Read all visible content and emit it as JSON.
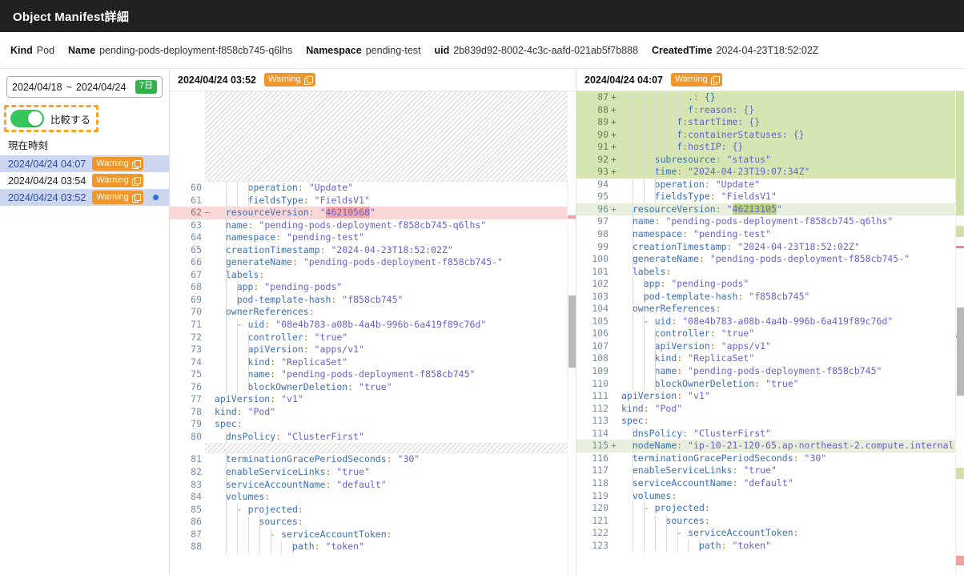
{
  "titlebar": {
    "title": "Object Manifest詳細"
  },
  "meta": [
    {
      "key": "Kind",
      "value": "Pod"
    },
    {
      "key": "Name",
      "value": "pending-pods-deployment-f858cb745-q6lhs"
    },
    {
      "key": "Namespace",
      "value": "pending-test"
    },
    {
      "key": "uid",
      "value": "2b839d92-8002-4c3c-aafd-021ab5f7b888"
    },
    {
      "key": "CreatedTime",
      "value": "2024-04-23T18:52:02Z"
    }
  ],
  "sidebar": {
    "date_range": {
      "from": "2024/04/18",
      "sep": "~",
      "to": "2024/04/24",
      "badge": "7日"
    },
    "compare_toggle": {
      "label": "比較する",
      "state": "on"
    },
    "now_label": "現在時刻",
    "snapshots": [
      {
        "timestamp": "2024/04/24 04:07",
        "severity": "Warning",
        "selected": true,
        "marker": false
      },
      {
        "timestamp": "2024/04/24 03:54",
        "severity": "Warning",
        "selected": false,
        "marker": false
      },
      {
        "timestamp": "2024/04/24 03:52",
        "severity": "Warning",
        "selected": true,
        "marker": true
      }
    ]
  },
  "colors": {
    "titlebar_bg": "#212121",
    "warning_chip": "#f0962a",
    "toggle_on": "#35c759",
    "badge_green": "#2eb24a",
    "selected_row": "#ccd6f0",
    "diff_add": "#d6e6b3",
    "diff_del": "#fbd7d7",
    "highlight_add": "#b9d47a",
    "highlight_del": "#f4a8a4",
    "accent_dashed": "#f5a623"
  },
  "panes": {
    "left": {
      "header_timestamp": "2024/04/24 03:52",
      "header_severity": "Warning",
      "leading_collapsed": true,
      "lines": [
        {
          "n": "60",
          "sign": "",
          "indent": 3,
          "text": "operation: \"Update\"",
          "state": ""
        },
        {
          "n": "61",
          "sign": "",
          "indent": 3,
          "text": "fieldsType: \"FieldsV1\"",
          "state": ""
        },
        {
          "n": "62",
          "sign": "−",
          "indent": 1,
          "text": "resourceVersion: \"46210568\"",
          "state": "del",
          "hl": "46210568"
        },
        {
          "n": "63",
          "sign": "",
          "indent": 1,
          "text": "name: \"pending-pods-deployment-f858cb745-q6lhs\"",
          "state": ""
        },
        {
          "n": "64",
          "sign": "",
          "indent": 1,
          "text": "namespace: \"pending-test\"",
          "state": ""
        },
        {
          "n": "65",
          "sign": "",
          "indent": 1,
          "text": "creationTimestamp: \"2024-04-23T18:52:02Z\"",
          "state": ""
        },
        {
          "n": "66",
          "sign": "",
          "indent": 1,
          "text": "generateName: \"pending-pods-deployment-f858cb745-\"",
          "state": ""
        },
        {
          "n": "67",
          "sign": "",
          "indent": 1,
          "text": "labels:",
          "state": ""
        },
        {
          "n": "68",
          "sign": "",
          "indent": 2,
          "text": "app: \"pending-pods\"",
          "state": ""
        },
        {
          "n": "69",
          "sign": "",
          "indent": 2,
          "text": "pod-template-hash: \"f858cb745\"",
          "state": ""
        },
        {
          "n": "70",
          "sign": "",
          "indent": 1,
          "text": "ownerReferences:",
          "state": ""
        },
        {
          "n": "71",
          "sign": "",
          "indent": 2,
          "text": "- uid: \"08e4b783-a08b-4a4b-996b-6a419f89c76d\"",
          "state": ""
        },
        {
          "n": "72",
          "sign": "",
          "indent": 3,
          "text": "controller: \"true\"",
          "state": ""
        },
        {
          "n": "73",
          "sign": "",
          "indent": 3,
          "text": "apiVersion: \"apps/v1\"",
          "state": ""
        },
        {
          "n": "74",
          "sign": "",
          "indent": 3,
          "text": "kind: \"ReplicaSet\"",
          "state": ""
        },
        {
          "n": "75",
          "sign": "",
          "indent": 3,
          "text": "name: \"pending-pods-deployment-f858cb745\"",
          "state": ""
        },
        {
          "n": "76",
          "sign": "",
          "indent": 3,
          "text": "blockOwnerDeletion: \"true\"",
          "state": ""
        },
        {
          "n": "77",
          "sign": "",
          "indent": 0,
          "text": "apiVersion: \"v1\"",
          "state": ""
        },
        {
          "n": "78",
          "sign": "",
          "indent": 0,
          "text": "kind: \"Pod\"",
          "state": ""
        },
        {
          "n": "79",
          "sign": "",
          "indent": 0,
          "text": "spec:",
          "state": ""
        },
        {
          "n": "80",
          "sign": "",
          "indent": 1,
          "text": "dnsPolicy: \"ClusterFirst\"",
          "state": ""
        },
        {
          "n": "",
          "sign": "",
          "indent": 0,
          "text": "",
          "state": "hatch"
        },
        {
          "n": "81",
          "sign": "",
          "indent": 1,
          "text": "terminationGracePeriodSeconds: \"30\"",
          "state": ""
        },
        {
          "n": "82",
          "sign": "",
          "indent": 1,
          "text": "enableServiceLinks: \"true\"",
          "state": ""
        },
        {
          "n": "83",
          "sign": "",
          "indent": 1,
          "text": "serviceAccountName: \"default\"",
          "state": ""
        },
        {
          "n": "84",
          "sign": "",
          "indent": 1,
          "text": "volumes:",
          "state": ""
        },
        {
          "n": "85",
          "sign": "",
          "indent": 2,
          "text": "- projected:",
          "state": ""
        },
        {
          "n": "86",
          "sign": "",
          "indent": 4,
          "text": "sources:",
          "state": ""
        },
        {
          "n": "87",
          "sign": "",
          "indent": 5,
          "text": "- serviceAccountToken:",
          "state": ""
        },
        {
          "n": "88",
          "sign": "",
          "indent": 7,
          "text": "path: \"token\"",
          "state": ""
        }
      ]
    },
    "right": {
      "header_timestamp": "2024/04/24 04:07",
      "header_severity": "Warning",
      "leading_collapsed": false,
      "lines": [
        {
          "n": "87",
          "sign": "+",
          "indent": 6,
          "text": ".: {}",
          "state": "add"
        },
        {
          "n": "88",
          "sign": "+",
          "indent": 6,
          "text": "f:reason: {}",
          "state": "add"
        },
        {
          "n": "89",
          "sign": "+",
          "indent": 5,
          "text": "f:startTime: {}",
          "state": "add"
        },
        {
          "n": "90",
          "sign": "+",
          "indent": 5,
          "text": "f:containerStatuses: {}",
          "state": "add"
        },
        {
          "n": "91",
          "sign": "+",
          "indent": 5,
          "text": "f:hostIP: {}",
          "state": "add"
        },
        {
          "n": "92",
          "sign": "+",
          "indent": 3,
          "text": "subresource: \"status\"",
          "state": "add"
        },
        {
          "n": "93",
          "sign": "+",
          "indent": 3,
          "text": "time: \"2024-04-23T19:07:34Z\"",
          "state": "add"
        },
        {
          "n": "94",
          "sign": "",
          "indent": 3,
          "text": "operation: \"Update\"",
          "state": ""
        },
        {
          "n": "95",
          "sign": "",
          "indent": 3,
          "text": "fieldsType: \"FieldsV1\"",
          "state": ""
        },
        {
          "n": "96",
          "sign": "+",
          "indent": 1,
          "text": "resourceVersion: \"46213105\"",
          "state": "mod-add",
          "hl": "46213105"
        },
        {
          "n": "97",
          "sign": "",
          "indent": 1,
          "text": "name: \"pending-pods-deployment-f858cb745-q6lhs\"",
          "state": ""
        },
        {
          "n": "98",
          "sign": "",
          "indent": 1,
          "text": "namespace: \"pending-test\"",
          "state": ""
        },
        {
          "n": "99",
          "sign": "",
          "indent": 1,
          "text": "creationTimestamp: \"2024-04-23T18:52:02Z\"",
          "state": ""
        },
        {
          "n": "100",
          "sign": "",
          "indent": 1,
          "text": "generateName: \"pending-pods-deployment-f858cb745-\"",
          "state": ""
        },
        {
          "n": "101",
          "sign": "",
          "indent": 1,
          "text": "labels:",
          "state": ""
        },
        {
          "n": "102",
          "sign": "",
          "indent": 2,
          "text": "app: \"pending-pods\"",
          "state": ""
        },
        {
          "n": "103",
          "sign": "",
          "indent": 2,
          "text": "pod-template-hash: \"f858cb745\"",
          "state": ""
        },
        {
          "n": "104",
          "sign": "",
          "indent": 1,
          "text": "ownerReferences:",
          "state": ""
        },
        {
          "n": "105",
          "sign": "",
          "indent": 2,
          "text": "- uid: \"08e4b783-a08b-4a4b-996b-6a419f89c76d\"",
          "state": ""
        },
        {
          "n": "106",
          "sign": "",
          "indent": 3,
          "text": "controller: \"true\"",
          "state": ""
        },
        {
          "n": "107",
          "sign": "",
          "indent": 3,
          "text": "apiVersion: \"apps/v1\"",
          "state": ""
        },
        {
          "n": "108",
          "sign": "",
          "indent": 3,
          "text": "kind: \"ReplicaSet\"",
          "state": ""
        },
        {
          "n": "109",
          "sign": "",
          "indent": 3,
          "text": "name: \"pending-pods-deployment-f858cb745\"",
          "state": ""
        },
        {
          "n": "110",
          "sign": "",
          "indent": 3,
          "text": "blockOwnerDeletion: \"true\"",
          "state": ""
        },
        {
          "n": "111",
          "sign": "",
          "indent": 0,
          "text": "apiVersion: \"v1\"",
          "state": ""
        },
        {
          "n": "112",
          "sign": "",
          "indent": 0,
          "text": "kind: \"Pod\"",
          "state": ""
        },
        {
          "n": "113",
          "sign": "",
          "indent": 0,
          "text": "spec:",
          "state": ""
        },
        {
          "n": "114",
          "sign": "",
          "indent": 1,
          "text": "dnsPolicy: \"ClusterFirst\"",
          "state": ""
        },
        {
          "n": "115",
          "sign": "+",
          "indent": 1,
          "text": "nodeName: \"ip-10-21-120-65.ap-northeast-2.compute.internal\"",
          "state": "mod-add"
        },
        {
          "n": "116",
          "sign": "",
          "indent": 1,
          "text": "terminationGracePeriodSeconds: \"30\"",
          "state": ""
        },
        {
          "n": "117",
          "sign": "",
          "indent": 1,
          "text": "enableServiceLinks: \"true\"",
          "state": ""
        },
        {
          "n": "118",
          "sign": "",
          "indent": 1,
          "text": "serviceAccountName: \"default\"",
          "state": ""
        },
        {
          "n": "119",
          "sign": "",
          "indent": 1,
          "text": "volumes:",
          "state": ""
        },
        {
          "n": "120",
          "sign": "",
          "indent": 2,
          "text": "- projected:",
          "state": ""
        },
        {
          "n": "121",
          "sign": "",
          "indent": 4,
          "text": "sources:",
          "state": ""
        },
        {
          "n": "122",
          "sign": "",
          "indent": 5,
          "text": "- serviceAccountToken:",
          "state": ""
        },
        {
          "n": "123",
          "sign": "",
          "indent": 7,
          "text": "path: \"token\"",
          "state": ""
        }
      ]
    }
  }
}
